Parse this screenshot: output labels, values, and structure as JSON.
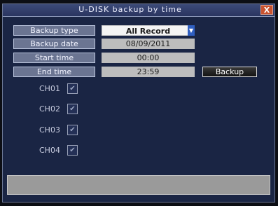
{
  "window": {
    "title": "U-DISK backup by time",
    "close_label": "X"
  },
  "form": {
    "backup_type": {
      "label": "Backup type",
      "value": "All Record"
    },
    "backup_date": {
      "label": "Backup date",
      "value": "08/09/2011"
    },
    "start_time": {
      "label": "Start time",
      "value": "00:00"
    },
    "end_time": {
      "label": "End time",
      "value": "23:59"
    }
  },
  "backup_button": "Backup",
  "channels": [
    {
      "label": "CH01",
      "checked": true
    },
    {
      "label": "CH02",
      "checked": true
    },
    {
      "label": "CH03",
      "checked": true
    },
    {
      "label": "CH04",
      "checked": true
    }
  ],
  "status": {
    "text": ""
  },
  "colors": {
    "panel": "#1a2544",
    "accent_blue": "#2f5fc1",
    "close": "#c8522f"
  }
}
